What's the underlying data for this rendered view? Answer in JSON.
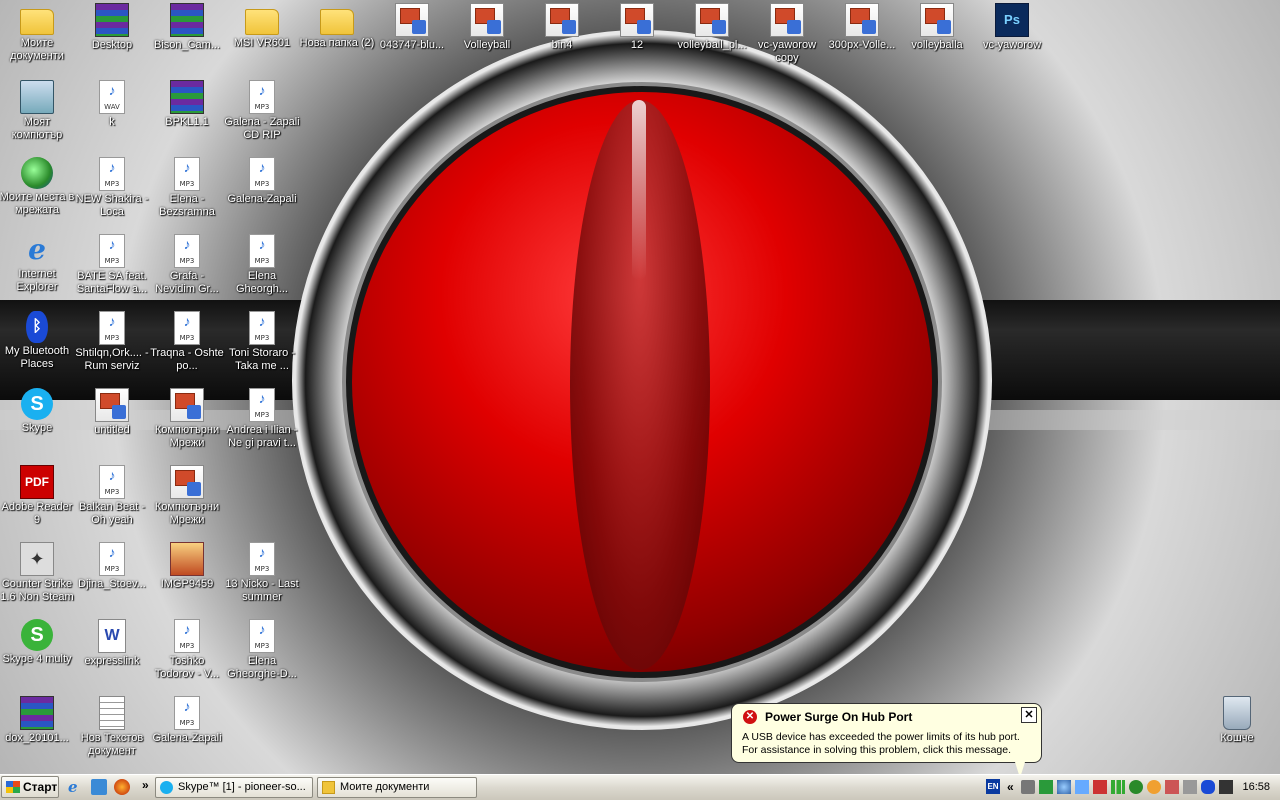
{
  "desktop": {
    "icons": [
      {
        "label": "Моите документи",
        "glyph": "folder-icon",
        "style": "g-folder"
      },
      {
        "label": "Desktop",
        "glyph": "rar-archive-icon",
        "style": "g-rar"
      },
      {
        "label": "Bison_Cam...",
        "glyph": "rar-archive-icon",
        "style": "g-rar"
      },
      {
        "label": "MSI VR601",
        "glyph": "folder-icon",
        "style": "g-folder"
      },
      {
        "label": "Нова папка (2)",
        "glyph": "folder-icon",
        "style": "g-folder"
      },
      {
        "label": "043747-blu...",
        "glyph": "powerpoint-icon",
        "style": "g-ppt"
      },
      {
        "label": "Volleyball",
        "glyph": "powerpoint-icon",
        "style": "g-ppt"
      },
      {
        "label": "bin4",
        "glyph": "powerpoint-icon",
        "style": "g-ppt"
      },
      {
        "label": "12",
        "glyph": "powerpoint-icon",
        "style": "g-ppt"
      },
      {
        "label": "volleyball_pl...",
        "glyph": "powerpoint-icon",
        "style": "g-ppt"
      },
      {
        "label": "vc-yaworow copy",
        "glyph": "powerpoint-icon",
        "style": "g-ppt"
      },
      {
        "label": "300px-Volle...",
        "glyph": "powerpoint-icon",
        "style": "g-ppt"
      },
      {
        "label": "volleyballa",
        "glyph": "powerpoint-icon",
        "style": "g-ppt"
      },
      {
        "label": "vc-yaworow",
        "glyph": "photoshop-icon",
        "style": "g-ps"
      },
      {
        "label": "Моят компютър",
        "glyph": "computer-icon",
        "style": "g-pc"
      },
      {
        "label": "k",
        "glyph": "wav-file-icon",
        "style": "g-mp3 g-wav"
      },
      {
        "label": "BPKL1.1",
        "glyph": "rar-archive-icon",
        "style": "g-rar"
      },
      {
        "label": "Galena - Zapali CD RIP",
        "glyph": "mp3-file-icon",
        "style": "g-mp3"
      },
      {
        "label": "Моите места в мрежата",
        "glyph": "network-places-icon",
        "style": "g-net"
      },
      {
        "label": "NEW Shakira - Loca",
        "glyph": "mp3-file-icon",
        "style": "g-mp3"
      },
      {
        "label": "Elena - Bezsramna",
        "glyph": "mp3-file-icon",
        "style": "g-mp3"
      },
      {
        "label": "Galena-Zapali",
        "glyph": "mp3-file-icon",
        "style": "g-mp3"
      },
      {
        "label": "Internet Explorer",
        "glyph": "internet-explorer-icon",
        "style": "g-ie"
      },
      {
        "label": "BATE SA feat. SantaFlow a...",
        "glyph": "mp3-file-icon",
        "style": "g-mp3"
      },
      {
        "label": "Grafa - Nevidim Gr...",
        "glyph": "mp3-file-icon",
        "style": "g-mp3"
      },
      {
        "label": "Elena Gheorgh...",
        "glyph": "mp3-file-icon",
        "style": "g-mp3"
      },
      {
        "label": "My Bluetooth Places",
        "glyph": "bluetooth-icon",
        "style": "g-bt"
      },
      {
        "label": "Shtilqn,Ork.... - Rum serviz",
        "glyph": "mp3-file-icon",
        "style": "g-mp3"
      },
      {
        "label": "Traqna - Oshte po...",
        "glyph": "mp3-file-icon",
        "style": "g-mp3"
      },
      {
        "label": "Toni Storaro -Taka me ...",
        "glyph": "mp3-file-icon",
        "style": "g-mp3"
      },
      {
        "label": "Skype",
        "glyph": "skype-icon",
        "style": "g-skype"
      },
      {
        "label": "untitled",
        "glyph": "powerpoint-icon",
        "style": "g-ppt"
      },
      {
        "label": "Компютърни Мрежи",
        "glyph": "powerpoint-icon",
        "style": "g-ppt"
      },
      {
        "label": "Andrea i Ilian - Ne gi pravi t...",
        "glyph": "mp3-file-icon",
        "style": "g-mp3"
      },
      {
        "label": "Adobe Reader 9",
        "glyph": "adobe-reader-icon",
        "style": "g-pdf"
      },
      {
        "label": "Balkan Beat - Oh yeah",
        "glyph": "mp3-file-icon",
        "style": "g-mp3"
      },
      {
        "label": "Компютърни Мрежи",
        "glyph": "powerpoint-icon",
        "style": "g-ppt"
      },
      {
        "label": "Counter Strike 1.6 Non Steam",
        "glyph": "counter-strike-icon",
        "style": "g-cs"
      },
      {
        "label": "Djina_Stoev...",
        "glyph": "mp3-file-icon",
        "style": "g-mp3"
      },
      {
        "label": "IMGP9459",
        "glyph": "image-file-icon",
        "style": "g-img"
      },
      {
        "label": "13 Nicko - Last summer",
        "glyph": "mp3-file-icon",
        "style": "g-mp3"
      },
      {
        "label": "Skype 4 multy",
        "glyph": "skype-icon",
        "style": "g-skype4"
      },
      {
        "label": "expresslink",
        "glyph": "word-document-icon",
        "style": "g-word"
      },
      {
        "label": "Toshko Todorov - V...",
        "glyph": "mp3-file-icon",
        "style": "g-mp3"
      },
      {
        "label": "Elena Gheorghe-D...",
        "glyph": "mp3-file-icon",
        "style": "g-mp3"
      },
      {
        "label": "dox_20101...",
        "glyph": "rar-archive-icon",
        "style": "g-rar"
      },
      {
        "label": "Нов Текстов документ",
        "glyph": "text-file-icon",
        "style": "g-txt"
      },
      {
        "label": "Galena-Zapali",
        "glyph": "mp3-file-icon",
        "style": "g-mp3"
      },
      {
        "label": "Кошче",
        "glyph": "recycle-bin-icon",
        "style": "g-trash"
      }
    ]
  },
  "balloon": {
    "title": "Power Surge On Hub Port",
    "message": "A USB device has exceeded the power limits of its hub port. For assistance in solving this problem, click this message.",
    "close_glyph": "✕"
  },
  "taskbar": {
    "start_label": "Старт",
    "more_glyph": "»",
    "windows": [
      {
        "label": "Skype™ [1] - pioneer-so..."
      },
      {
        "label": "Моите документи"
      }
    ],
    "tray": {
      "language": "EN",
      "expand_glyph": "«",
      "clock": "16:58"
    }
  }
}
